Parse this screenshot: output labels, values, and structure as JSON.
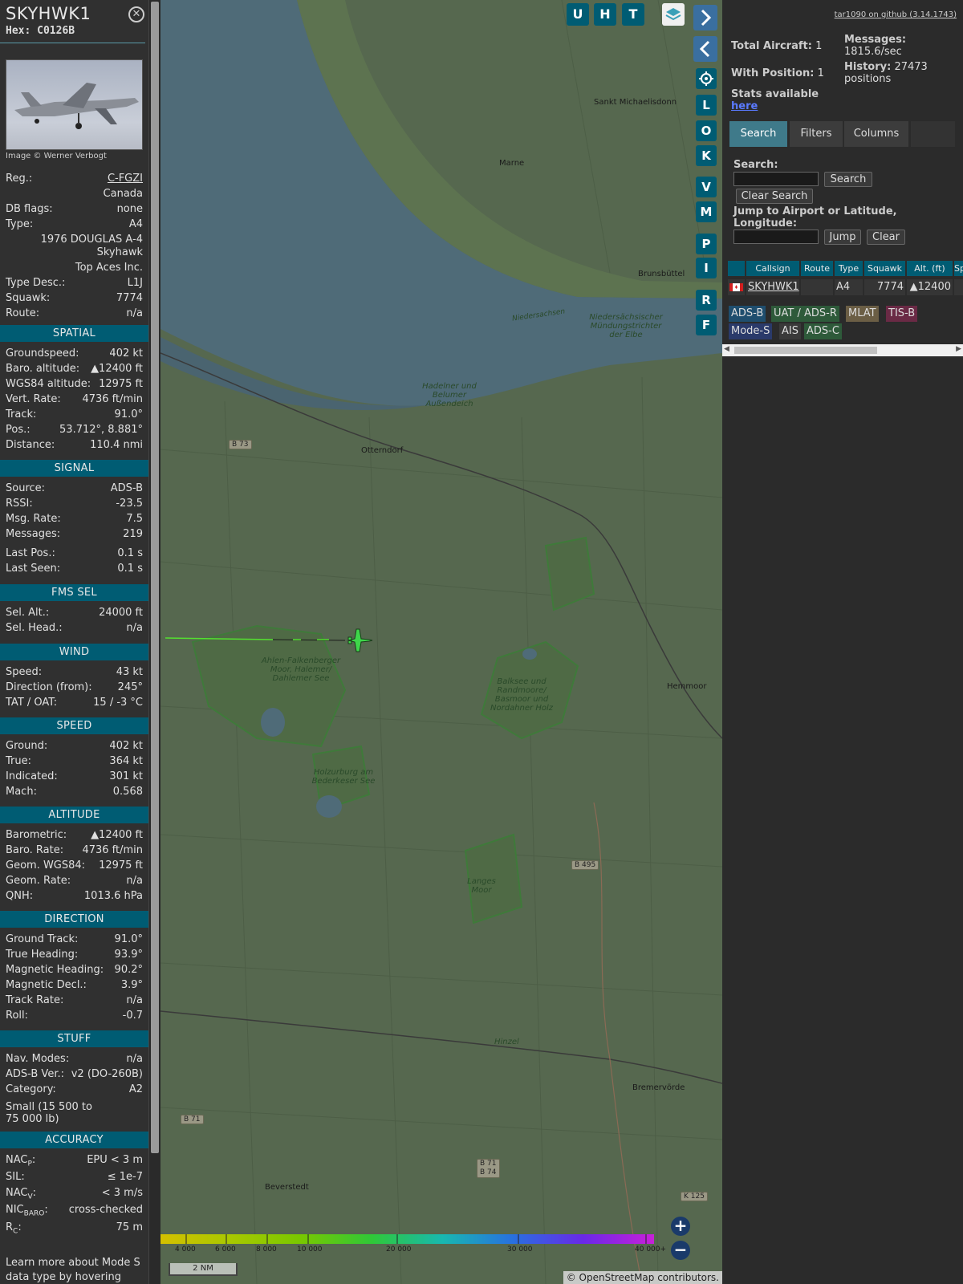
{
  "aircraft": {
    "callsign": "SKYHWK1",
    "hex_label": "Hex: C0126B",
    "photo_credit": "Image © Werner Verbogt",
    "reg_label": "Reg.:",
    "reg": "C-FGZI",
    "country": "Canada",
    "dbflags_label": "DB flags:",
    "dbflags": "none",
    "type_label": "Type:",
    "type": "A4",
    "model_line1": "1976 DOUGLAS A-4",
    "model_line2": "Skyhawk",
    "owner": "Top Aces Inc.",
    "typedesc_label": "Type Desc.:",
    "typedesc": "L1J",
    "squawk_label": "Squawk:",
    "squawk": "7774",
    "route_label": "Route:",
    "route": "n/a"
  },
  "sections": {
    "spatial": {
      "title": "SPATIAL",
      "rows": [
        {
          "k": "Groundspeed:",
          "v": "402 kt"
        },
        {
          "k": "Baro. altitude:",
          "v": "▲12400 ft"
        },
        {
          "k": "WGS84 altitude:",
          "v": "12975 ft"
        },
        {
          "k": "Vert. Rate:",
          "v": "4736 ft/min"
        },
        {
          "k": "Track:",
          "v": "91.0°"
        },
        {
          "k": "Pos.:",
          "v": "53.712°, 8.881°"
        },
        {
          "k": "Distance:",
          "v": "110.4 nmi"
        }
      ]
    },
    "signal": {
      "title": "SIGNAL",
      "rows": [
        {
          "k": "Source:",
          "v": "ADS-B"
        },
        {
          "k": "RSSI:",
          "v": "-23.5"
        },
        {
          "k": "Msg. Rate:",
          "v": "7.5"
        },
        {
          "k": "Messages:",
          "v": "219"
        },
        {
          "k": "Last Pos.:",
          "v": "0.1 s"
        },
        {
          "k": "Last Seen:",
          "v": "0.1 s"
        }
      ]
    },
    "fms": {
      "title": "FMS SEL",
      "rows": [
        {
          "k": "Sel. Alt.:",
          "v": "24000 ft"
        },
        {
          "k": "Sel. Head.:",
          "v": "n/a"
        }
      ]
    },
    "wind": {
      "title": "WIND",
      "rows": [
        {
          "k": "Speed:",
          "v": "43 kt"
        },
        {
          "k": "Direction (from):",
          "v": "245°"
        },
        {
          "k": "TAT / OAT:",
          "v": "15 / -3 °C"
        }
      ]
    },
    "speed": {
      "title": "SPEED",
      "rows": [
        {
          "k": "Ground:",
          "v": "402 kt"
        },
        {
          "k": "True:",
          "v": "364 kt"
        },
        {
          "k": "Indicated:",
          "v": "301 kt"
        },
        {
          "k": "Mach:",
          "v": "0.568"
        }
      ]
    },
    "altitude": {
      "title": "ALTITUDE",
      "rows": [
        {
          "k": "Barometric:",
          "v": "▲12400 ft"
        },
        {
          "k": "Baro. Rate:",
          "v": "4736 ft/min"
        },
        {
          "k": "Geom. WGS84:",
          "v": "12975 ft"
        },
        {
          "k": "Geom. Rate:",
          "v": "n/a"
        },
        {
          "k": "QNH:",
          "v": "1013.6 hPa"
        }
      ]
    },
    "direction": {
      "title": "DIRECTION",
      "rows": [
        {
          "k": "Ground Track:",
          "v": "91.0°"
        },
        {
          "k": "True Heading:",
          "v": "93.9°"
        },
        {
          "k": "Magnetic Heading:",
          "v": "90.2°"
        },
        {
          "k": "Magnetic Decl.:",
          "v": "3.9°"
        },
        {
          "k": "Track Rate:",
          "v": "n/a"
        },
        {
          "k": "Roll:",
          "v": "-0.7"
        }
      ]
    },
    "stuff": {
      "title": "STUFF",
      "rows": [
        {
          "k": "Nav. Modes:",
          "v": "n/a"
        },
        {
          "k": "ADS-B Ver.:",
          "v": "v2 (DO-260B)"
        },
        {
          "k": "Category:",
          "v": "A2"
        }
      ],
      "category_desc": "Small (15 500 to 75 000 lb)"
    },
    "accuracy": {
      "title": "ACCURACY",
      "nacp_k": "NAC",
      "nacp_sub": "P",
      "nacp_v": "EPU < 3 m",
      "sil_k": "SIL:",
      "sil_v": "≤ 1e-7",
      "nacv_k": "NAC",
      "nacv_sub": "V",
      "nacv_v": "< 3 m/s",
      "nicbaro_k": "NIC",
      "nicbaro_sub": "BARO",
      "nicbaro_v": "cross-checked",
      "rc_k": "R",
      "rc_sub": "C",
      "rc_v": "75 m"
    },
    "footer_note": "Learn more about Mode S data type by hovering over"
  },
  "map": {
    "places": [
      "Sankt Michaelisdonn",
      "Marne",
      "Brunsbüttel",
      "Otterndorf",
      "Hemmoor",
      "Bremervörde",
      "Beverstedt",
      "Hinzel",
      "Niedersachsen"
    ],
    "nature": [
      "Niedersächsischer Mündungstrichter der Elbe",
      "Hadelner und Belumer Außendeich",
      "Ahlen-Falkenberger Moor, Halemer/ Dahlemer See",
      "Balksee und Randmoore/ Basmoor und Nordahner Holz",
      "Holzurburg am Bederkeser See",
      "Langes Moor"
    ],
    "roads": [
      "B 73",
      "B 495",
      "B 71",
      "B 71",
      "B 74",
      "K 125"
    ],
    "buttons": [
      "U",
      "H",
      "T",
      "L",
      "O",
      "K",
      "V",
      "M",
      "P",
      "I",
      "R",
      "F"
    ],
    "legend_labels": [
      "4 000",
      "6 000",
      "8 000",
      "10 000",
      "20 000",
      "30 000",
      "40 000+"
    ],
    "legend_colors": [
      "#d4c000",
      "#a8c800",
      "#78c800",
      "#2fc838",
      "#18b8b0",
      "#2870e0",
      "#6a28e8",
      "#c820d8"
    ],
    "scale_label": "2 NM",
    "zoom_in": "+",
    "zoom_out": "−",
    "attribution": "© OpenStreetMap contributors."
  },
  "panel": {
    "github": "tar1090 on github (3.14.1743)",
    "total_label": "Total Aircraft:",
    "total": "1",
    "withpos_label": "With Position:",
    "withpos": "1",
    "messages_label": "Messages:",
    "messages": "1815.6/sec",
    "history_label": "History:",
    "history": "27473 positions",
    "stats_label": "Stats available",
    "stats_link": "here",
    "tabs": [
      "Search",
      "Filters",
      "Columns"
    ],
    "search_label": "Search:",
    "search_btn": "Search",
    "clear_search_btn": "Clear Search",
    "jump_label": "Jump to Airport or Latitude, Longitude:",
    "jump_btn": "Jump",
    "clear_btn": "Clear",
    "columns": [
      "Callsign",
      "Route",
      "Type",
      "Squawk",
      "Alt. (ft)",
      "Sp"
    ],
    "row": {
      "callsign": "SKYHWK1",
      "route": "",
      "type": "A4",
      "squawk": "7774",
      "alt": "▲12400"
    },
    "badges": [
      {
        "label": "ADS-B",
        "bg": "#1f4e6e"
      },
      {
        "label": "UAT / ADS-R",
        "bg": "#2e5a3a"
      },
      {
        "label": "MLAT",
        "bg": "#6b5e45"
      },
      {
        "label": "TIS-B",
        "bg": "#6a2a45"
      },
      {
        "label": "Mode-S",
        "bg": "#2a3a6a"
      },
      {
        "label": "AIS",
        "bg": "#3a3a3a"
      },
      {
        "label": "ADS-C",
        "bg": "#2e5a3a"
      }
    ]
  }
}
